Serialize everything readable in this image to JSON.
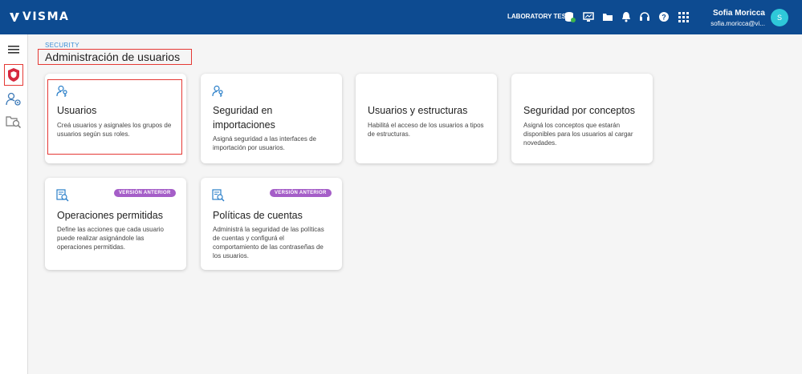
{
  "topbar": {
    "logo_text": "VISMA",
    "environment": "LABORATORY TEST",
    "icons": [
      "database-check-icon",
      "monitor-icon",
      "folder-icon",
      "bell-icon",
      "headset-icon",
      "help-icon",
      "apps-grid-icon"
    ],
    "user_name": "Sofia Moricca",
    "user_email": "sofia.moricca@vi...",
    "avatar_initial": "S"
  },
  "sidebar": {
    "items": [
      "menu-icon",
      "security-shield-icon",
      "users-settings-icon",
      "search-documents-icon"
    ]
  },
  "page": {
    "breadcrumb": "SECURITY",
    "title": "Administración de usuarios"
  },
  "cards": [
    {
      "title": "Usuarios",
      "description": "Creá usuarios y asignales los grupos de usuarios según sus roles.",
      "icon": "user-key-icon"
    },
    {
      "title": "Seguridad en importaciones",
      "description": "Asigná seguridad a las interfaces de importación por usuarios.",
      "icon": "user-key-icon"
    },
    {
      "title": "Usuarios y estructuras",
      "description": "Habilitá el acceso de los usuarios a tipos de estructuras.",
      "icon": ""
    },
    {
      "title": "Seguridad por conceptos",
      "description": "Asigná los conceptos que estarán disponibles para los usuarios al cargar novedades.",
      "icon": ""
    },
    {
      "title": "Operaciones permitidas",
      "description": "Define las acciones que cada usuario puede realizar asignándole las operaciones permitidas.",
      "icon": "document-search-icon",
      "badge": "VERSIÓN ANTERIOR"
    },
    {
      "title": "Políticas de cuentas",
      "description": "Administrá la seguridad de las políticas de cuentas y configurá el comportamiento de las contraseñas de los usuarios.",
      "icon": "document-search-icon",
      "badge": "VERSIÓN ANTERIOR"
    }
  ],
  "colors": {
    "topbar": "#0d4b91",
    "accent": "#3d8fd6",
    "badge": "#a55ec8",
    "highlight": "#e53935",
    "avatar": "#2ec8d9"
  }
}
